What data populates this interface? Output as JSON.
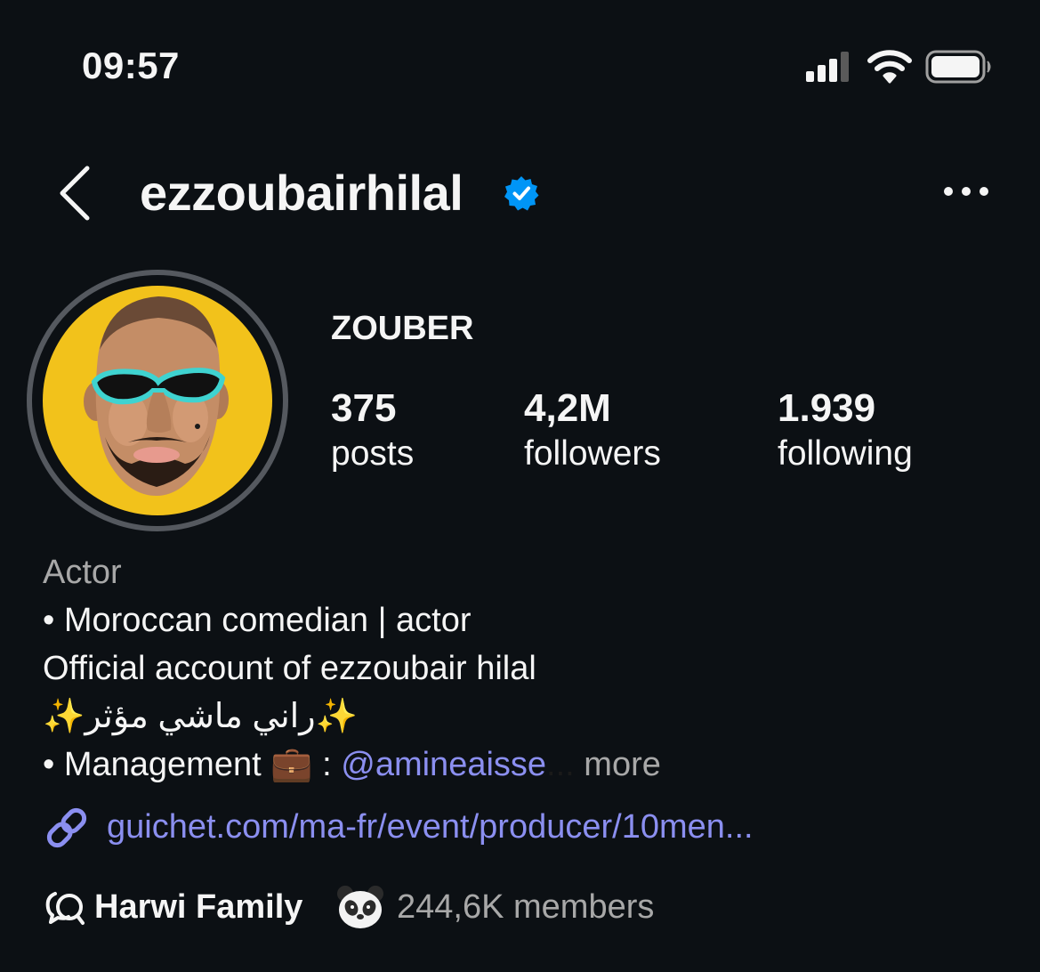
{
  "status_bar": {
    "time": "09:57",
    "icons": [
      "cellular-signal-icon",
      "wifi-icon",
      "battery-icon"
    ]
  },
  "header": {
    "username": "ezzoubairhilal",
    "verified": true,
    "back_icon": "chevron-left-icon",
    "menu_icon": "more-horizontal-icon"
  },
  "profile": {
    "display_name": "ZOUBER",
    "stats": [
      {
        "value": "375",
        "label": "posts"
      },
      {
        "value": "4,2M",
        "label": "followers"
      },
      {
        "value": "1.939",
        "label": "following"
      }
    ]
  },
  "bio": {
    "category": "Actor",
    "line1": "• Moroccan comedian | actor",
    "line2": "Official account of ezzoubair hilal",
    "line3_sparkle_left": "✨",
    "line3_text": "راني ماشي مؤثر",
    "line3_sparkle_right": "✨",
    "line4_prefix": "• Management",
    "line4_emoji": "💼",
    "line4_colon": ":",
    "mention": "@amineaisse",
    "ellipsis": "...",
    "more_label": "more"
  },
  "link": {
    "icon": "link-icon",
    "text": "guichet.com/ma-fr/event/producer/10men..."
  },
  "channel": {
    "icon": "broadcast-chat-icon",
    "name": "Harwi Family",
    "emoji": "panda-emoji",
    "members": "244,6K members"
  },
  "colors": {
    "background": "#0c1014",
    "text": "#f5f5f5",
    "secondary": "#a8a8a8",
    "link": "#8b8ff0",
    "verified": "#0095f6",
    "avatar_bg": "#f2c21b"
  }
}
